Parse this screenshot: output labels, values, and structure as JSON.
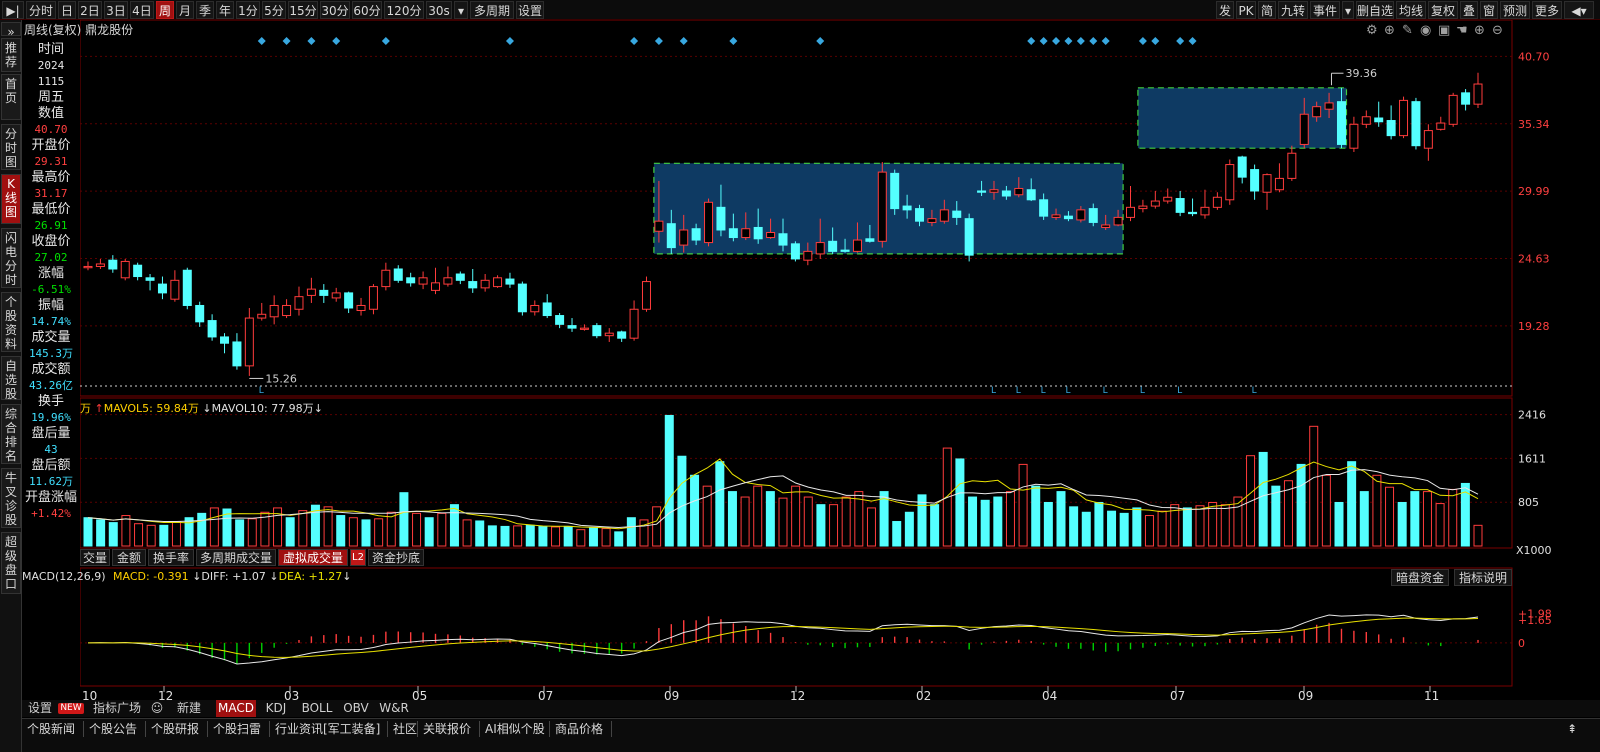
{
  "toolbar": {
    "items": [
      {
        "label": "▶|",
        "active": false
      },
      {
        "label": "分时",
        "active": false
      },
      {
        "label": "日",
        "active": false
      },
      {
        "label": "2日",
        "active": false
      },
      {
        "label": "3日",
        "active": false
      },
      {
        "label": "4日",
        "active": false
      },
      {
        "label": "周",
        "active": true
      },
      {
        "label": "月",
        "active": false
      },
      {
        "label": "季",
        "active": false
      },
      {
        "label": "年",
        "active": false
      },
      {
        "label": "1分",
        "active": false
      },
      {
        "label": "5分",
        "active": false
      },
      {
        "label": "15分",
        "active": false
      },
      {
        "label": "30分",
        "active": false
      },
      {
        "label": "60分",
        "active": false
      },
      {
        "label": "120分",
        "active": false
      },
      {
        "label": "30s",
        "active": false
      },
      {
        "label": "▾",
        "active": false
      },
      {
        "label": "多周期",
        "active": false
      },
      {
        "label": "设置",
        "active": false
      }
    ],
    "right_items": [
      "发",
      "PK",
      "简",
      "九转",
      "事件",
      "▾",
      "删自选",
      "均线",
      "复权",
      "叠",
      "窗",
      "预测",
      "更多",
      "◀▾"
    ]
  },
  "sidebar": {
    "items": [
      {
        "label": "»",
        "active": false
      },
      {
        "label": "推荐",
        "active": false
      },
      {
        "label": "首页",
        "active": false
      },
      {
        "label": "分时图",
        "active": false
      },
      {
        "label": "K线图",
        "active": true
      },
      {
        "label": "闪电分时",
        "active": false
      },
      {
        "label": "个股资料",
        "active": false
      },
      {
        "label": "自选股",
        "active": false
      },
      {
        "label": "综合排名",
        "active": false
      },
      {
        "label": "牛叉诊股",
        "active": false
      },
      {
        "label": "超级盘口",
        "active": false
      }
    ]
  },
  "chart_title": "周线(复权)  鼎龙股份",
  "info_panel": {
    "rows": [
      {
        "label": "时间",
        "value": "2024",
        "color": "#e6e6e6"
      },
      {
        "label": "",
        "value": "1115",
        "color": "#e6e6e6"
      },
      {
        "label": "周五",
        "value": "",
        "color": "#e6e6e6"
      },
      {
        "label": "数值",
        "value": "40.70",
        "color": "#ff4040"
      },
      {
        "label": "开盘价",
        "value": "29.31",
        "color": "#ff4040"
      },
      {
        "label": "最高价",
        "value": "31.17",
        "color": "#ff4040"
      },
      {
        "label": "最低价",
        "value": "26.91",
        "color": "#00e000"
      },
      {
        "label": "收盘价",
        "value": "27.02",
        "color": "#00e000"
      },
      {
        "label": "涨幅",
        "value": "-6.51%",
        "color": "#00e000"
      },
      {
        "label": "振幅",
        "value": "14.74%",
        "color": "#40e0ff"
      },
      {
        "label": "成交量",
        "value": "145.3万",
        "color": "#40e0ff"
      },
      {
        "label": "成交额",
        "value": "43.26亿",
        "color": "#40e0ff"
      },
      {
        "label": "换手",
        "value": "19.96%",
        "color": "#40e0ff"
      },
      {
        "label": "盘后量",
        "value": "43",
        "color": "#40e0ff"
      },
      {
        "label": "盘后额",
        "value": "11.62万",
        "color": "#40e0ff"
      },
      {
        "label": "开盘涨幅",
        "value": "+1.42%",
        "color": "#ff4040"
      }
    ]
  },
  "price_axis": [
    "40.70",
    "35.34",
    "29.99",
    "24.63",
    "19.28"
  ],
  "volume_axis": [
    "2416",
    "1611",
    "805",
    "X1000"
  ],
  "macd_axis": [
    "1.98",
    "1.65",
    "0"
  ],
  "date_axis": [
    "10",
    "12",
    "03",
    "05",
    "07",
    "09",
    "12",
    "02",
    "04",
    "07",
    "09",
    "11"
  ],
  "annotations": {
    "low": "15.26",
    "high": "39.36"
  },
  "volume_legend": {
    "unit": "万",
    "mavol5": "MAVOL5: 59.84万",
    "mavol10": "MAVOL10: 77.98万"
  },
  "volume_tabs": [
    {
      "label": "交量",
      "active": false
    },
    {
      "label": "金额",
      "active": false
    },
    {
      "label": "换手率",
      "active": false
    },
    {
      "label": "多周期成交量",
      "active": false
    },
    {
      "label": "虚拟成交量",
      "active": true
    },
    {
      "label": "L2",
      "active": false
    },
    {
      "label": "资金抄底",
      "active": false
    }
  ],
  "macd_legend": {
    "name": "MACD(12,26,9)",
    "macd": "MACD: -0.391",
    "diff": "DIFF: +1.07",
    "dea": "DEA: +1.27"
  },
  "macd_buttons": [
    "暗盘资金",
    "指标说明"
  ],
  "indicator_tabs": [
    {
      "label": "设置",
      "active": false
    },
    {
      "label": "指标广场",
      "active": false
    },
    {
      "label": "新建",
      "active": false
    },
    {
      "label": "MACD",
      "active": true
    },
    {
      "label": "KDJ",
      "active": false
    },
    {
      "label": "BOLL",
      "active": false
    },
    {
      "label": "OBV",
      "active": false
    },
    {
      "label": "W&R",
      "active": false
    }
  ],
  "new_badge": "NEW",
  "news_tabs": [
    "个股新闻",
    "个股公告",
    "个股研报",
    "个股扫雷",
    "行业资讯[军工装备]",
    "社区",
    "关联报价",
    "AI相似个股",
    "商品价格"
  ],
  "colors": {
    "up": "#ff3c3c",
    "down": "#54ffff",
    "ma5": "#e8e8e8",
    "ma10": "#e8e000",
    "box": "#0e3a63",
    "box_border": "#40d040"
  },
  "chart_data": {
    "type": "candlestick",
    "ylim": [
      14.5,
      42.0
    ],
    "candles": [
      [
        23.9,
        24.0,
        24.4,
        23.7
      ],
      [
        24.0,
        24.2,
        24.6,
        23.8
      ],
      [
        24.5,
        23.8,
        24.9,
        23.5
      ],
      [
        23.1,
        24.4,
        24.6,
        22.9
      ],
      [
        24.1,
        23.2,
        24.3,
        22.9
      ],
      [
        23.1,
        22.9,
        23.4,
        22.1
      ],
      [
        22.6,
        21.9,
        23.2,
        21.4
      ],
      [
        21.4,
        22.9,
        23.7,
        21.2
      ],
      [
        23.7,
        20.9,
        23.9,
        20.6
      ],
      [
        20.9,
        19.6,
        21.2,
        19.2
      ],
      [
        19.7,
        18.4,
        20.2,
        18.1
      ],
      [
        18.4,
        17.9,
        18.7,
        17.1
      ],
      [
        18.0,
        16.1,
        18.7,
        15.8
      ],
      [
        16.1,
        19.9,
        20.7,
        15.3
      ],
      [
        19.9,
        20.2,
        21.1,
        19.7
      ],
      [
        20.0,
        20.9,
        21.7,
        19.4
      ],
      [
        20.1,
        20.9,
        21.4,
        19.9
      ],
      [
        20.6,
        21.6,
        22.4,
        20.1
      ],
      [
        21.7,
        22.2,
        23.1,
        21.1
      ],
      [
        22.1,
        21.7,
        22.6,
        21.1
      ],
      [
        21.5,
        21.9,
        22.3,
        21.2
      ],
      [
        21.9,
        20.7,
        22.0,
        20.3
      ],
      [
        20.5,
        20.9,
        21.5,
        20.1
      ],
      [
        20.6,
        22.4,
        22.6,
        20.2
      ],
      [
        22.4,
        23.7,
        24.3,
        22.1
      ],
      [
        23.8,
        22.9,
        24.1,
        22.7
      ],
      [
        23.1,
        22.7,
        23.5,
        22.4
      ],
      [
        22.6,
        23.1,
        23.6,
        22.2
      ],
      [
        22.1,
        22.7,
        23.9,
        21.8
      ],
      [
        22.6,
        23.1,
        24.0,
        22.4
      ],
      [
        23.4,
        22.9,
        23.6,
        22.6
      ],
      [
        22.8,
        22.3,
        23.8,
        21.9
      ],
      [
        22.3,
        22.9,
        23.4,
        22.0
      ],
      [
        22.4,
        23.1,
        23.3,
        22.3
      ],
      [
        23.0,
        22.6,
        23.5,
        22.3
      ],
      [
        22.6,
        20.4,
        22.8,
        20.1
      ],
      [
        20.4,
        20.9,
        21.3,
        20.1
      ],
      [
        21.1,
        20.1,
        21.8,
        19.9
      ],
      [
        20.1,
        19.4,
        20.3,
        19.1
      ],
      [
        19.3,
        19.1,
        19.9,
        18.8
      ],
      [
        19.0,
        19.1,
        19.4,
        18.9
      ],
      [
        19.3,
        18.5,
        19.5,
        18.3
      ],
      [
        18.5,
        18.7,
        19.1,
        18.0
      ],
      [
        18.8,
        18.3,
        18.9,
        18.0
      ],
      [
        18.3,
        20.6,
        21.3,
        18.1
      ],
      [
        20.6,
        22.8,
        23.2,
        20.4
      ],
      [
        26.8,
        27.6,
        30.8,
        25.9
      ],
      [
        27.4,
        25.5,
        28.5,
        25.0
      ],
      [
        25.7,
        26.9,
        28.1,
        25.1
      ],
      [
        27.0,
        26.1,
        27.4,
        25.7
      ],
      [
        25.9,
        29.1,
        29.4,
        25.6
      ],
      [
        28.7,
        26.9,
        30.5,
        26.4
      ],
      [
        27.0,
        26.3,
        28.2,
        26.0
      ],
      [
        26.3,
        27.0,
        28.3,
        26.1
      ],
      [
        27.1,
        26.2,
        28.6,
        25.8
      ],
      [
        26.3,
        26.7,
        27.8,
        26.2
      ],
      [
        26.6,
        25.7,
        27.8,
        25.2
      ],
      [
        25.8,
        24.6,
        26.0,
        24.4
      ],
      [
        24.5,
        25.2,
        25.9,
        24.1
      ],
      [
        25.0,
        25.9,
        27.8,
        24.6
      ],
      [
        26.0,
        25.2,
        27.1,
        25.0
      ],
      [
        25.3,
        25.2,
        26.2,
        25.1
      ],
      [
        25.2,
        26.1,
        27.5,
        25.1
      ],
      [
        26.2,
        26.0,
        27.3,
        25.9
      ],
      [
        26.0,
        31.5,
        32.3,
        25.5
      ],
      [
        31.4,
        28.6,
        31.7,
        28.1
      ],
      [
        28.8,
        28.5,
        29.7,
        27.8
      ],
      [
        28.6,
        27.6,
        28.9,
        27.2
      ],
      [
        27.5,
        27.8,
        28.5,
        27.2
      ],
      [
        27.6,
        28.5,
        29.3,
        27.4
      ],
      [
        28.4,
        27.9,
        29.2,
        27.3
      ],
      [
        27.8,
        24.9,
        28.2,
        24.4
      ],
      [
        30.0,
        29.9,
        30.8,
        29.6
      ],
      [
        29.9,
        30.1,
        30.8,
        29.3
      ],
      [
        30.0,
        29.6,
        30.4,
        29.3
      ],
      [
        29.7,
        30.2,
        31.1,
        29.5
      ],
      [
        30.1,
        29.3,
        31.0,
        29.2
      ],
      [
        29.3,
        28.0,
        29.8,
        27.7
      ],
      [
        27.9,
        28.1,
        28.6,
        27.7
      ],
      [
        28.0,
        27.8,
        28.4,
        27.6
      ],
      [
        27.7,
        28.5,
        28.8,
        27.5
      ],
      [
        28.6,
        27.5,
        29.0,
        27.2
      ],
      [
        27.1,
        27.3,
        28.1,
        26.9
      ],
      [
        27.3,
        27.9,
        28.5,
        27.2
      ],
      [
        27.9,
        28.7,
        30.4,
        27.6
      ],
      [
        28.6,
        28.8,
        29.3,
        28.3
      ],
      [
        28.8,
        29.2,
        30.0,
        28.6
      ],
      [
        29.2,
        29.5,
        30.2,
        29.0
      ],
      [
        29.4,
        28.3,
        30.0,
        28.0
      ],
      [
        28.3,
        28.2,
        29.4,
        28.0
      ],
      [
        28.1,
        28.7,
        30.1,
        27.8
      ],
      [
        28.7,
        29.5,
        29.9,
        28.5
      ],
      [
        29.3,
        32.1,
        32.5,
        28.9
      ],
      [
        32.7,
        31.1,
        32.8,
        30.6
      ],
      [
        31.7,
        30.0,
        32.1,
        29.3
      ],
      [
        29.9,
        31.3,
        31.4,
        28.5
      ],
      [
        30.1,
        31.0,
        32.2,
        29.9
      ],
      [
        31.0,
        33.0,
        33.6,
        30.8
      ],
      [
        33.7,
        36.1,
        37.4,
        33.4
      ],
      [
        35.9,
        36.7,
        37.1,
        35.5
      ],
      [
        36.5,
        37.0,
        37.8,
        35.8
      ],
      [
        37.1,
        33.7,
        38.2,
        33.4
      ],
      [
        33.4,
        35.3,
        35.9,
        33.1
      ],
      [
        35.3,
        35.9,
        36.4,
        35.0
      ],
      [
        35.8,
        35.5,
        37.1,
        35.1
      ],
      [
        35.6,
        34.4,
        36.8,
        34.1
      ],
      [
        34.4,
        37.2,
        37.5,
        34.2
      ],
      [
        37.1,
        33.6,
        37.4,
        33.3
      ],
      [
        33.4,
        34.8,
        35.3,
        32.4
      ],
      [
        34.9,
        35.4,
        35.9,
        34.8
      ],
      [
        35.3,
        37.6,
        37.8,
        35.1
      ],
      [
        37.8,
        36.9,
        38.1,
        36.4
      ],
      [
        36.9,
        38.5,
        39.4,
        36.6
      ]
    ],
    "volume": [
      [
        520,
        0
      ],
      [
        480,
        0
      ],
      [
        430,
        0
      ],
      [
        560,
        1
      ],
      [
        410,
        1
      ],
      [
        380,
        1
      ],
      [
        380,
        0
      ],
      [
        440,
        1
      ],
      [
        520,
        0
      ],
      [
        600,
        0
      ],
      [
        700,
        1
      ],
      [
        680,
        0
      ],
      [
        480,
        0
      ],
      [
        500,
        1
      ],
      [
        620,
        1
      ],
      [
        700,
        1
      ],
      [
        520,
        0
      ],
      [
        650,
        1
      ],
      [
        750,
        0
      ],
      [
        720,
        1
      ],
      [
        560,
        0
      ],
      [
        520,
        1
      ],
      [
        480,
        0
      ],
      [
        500,
        1
      ],
      [
        620,
        1
      ],
      [
        980,
        0
      ],
      [
        600,
        1
      ],
      [
        520,
        0
      ],
      [
        600,
        1
      ],
      [
        760,
        0
      ],
      [
        480,
        1
      ],
      [
        460,
        0
      ],
      [
        370,
        0
      ],
      [
        360,
        0
      ],
      [
        370,
        1
      ],
      [
        380,
        0
      ],
      [
        360,
        0
      ],
      [
        350,
        1
      ],
      [
        360,
        0
      ],
      [
        300,
        1
      ],
      [
        340,
        0
      ],
      [
        320,
        1
      ],
      [
        260,
        0
      ],
      [
        520,
        0
      ],
      [
        480,
        1
      ],
      [
        720,
        1
      ],
      [
        2400,
        0
      ],
      [
        1650,
        0
      ],
      [
        1300,
        0
      ],
      [
        1100,
        1
      ],
      [
        1550,
        0
      ],
      [
        1000,
        0
      ],
      [
        900,
        1
      ],
      [
        1100,
        1
      ],
      [
        1000,
        0
      ],
      [
        880,
        1
      ],
      [
        1100,
        1
      ],
      [
        900,
        1
      ],
      [
        760,
        0
      ],
      [
        760,
        1
      ],
      [
        900,
        1
      ],
      [
        1000,
        1
      ],
      [
        700,
        1
      ],
      [
        1000,
        0
      ],
      [
        450,
        0
      ],
      [
        620,
        0
      ],
      [
        940,
        0
      ],
      [
        760,
        0
      ],
      [
        1800,
        1
      ],
      [
        1600,
        0
      ],
      [
        900,
        0
      ],
      [
        840,
        0
      ],
      [
        900,
        0
      ],
      [
        1000,
        1
      ],
      [
        1500,
        1
      ],
      [
        1100,
        0
      ],
      [
        800,
        0
      ],
      [
        1000,
        0
      ],
      [
        720,
        0
      ],
      [
        620,
        0
      ],
      [
        800,
        0
      ],
      [
        640,
        0
      ],
      [
        600,
        0
      ],
      [
        700,
        0
      ],
      [
        560,
        1
      ],
      [
        640,
        1
      ],
      [
        760,
        1
      ],
      [
        700,
        0
      ],
      [
        740,
        1
      ],
      [
        800,
        1
      ],
      [
        760,
        1
      ],
      [
        900,
        1
      ],
      [
        1660,
        1
      ],
      [
        1720,
        0
      ],
      [
        1100,
        0
      ],
      [
        1200,
        1
      ],
      [
        1500,
        0
      ],
      [
        2200,
        1
      ],
      [
        1300,
        1
      ],
      [
        800,
        0
      ],
      [
        1550,
        0
      ],
      [
        1000,
        0
      ],
      [
        1300,
        1
      ],
      [
        1080,
        1
      ],
      [
        800,
        0
      ],
      [
        1000,
        0
      ],
      [
        1000,
        1
      ],
      [
        780,
        1
      ],
      [
        1040,
        1
      ],
      [
        1150,
        0
      ],
      [
        380,
        1
      ]
    ]
  }
}
